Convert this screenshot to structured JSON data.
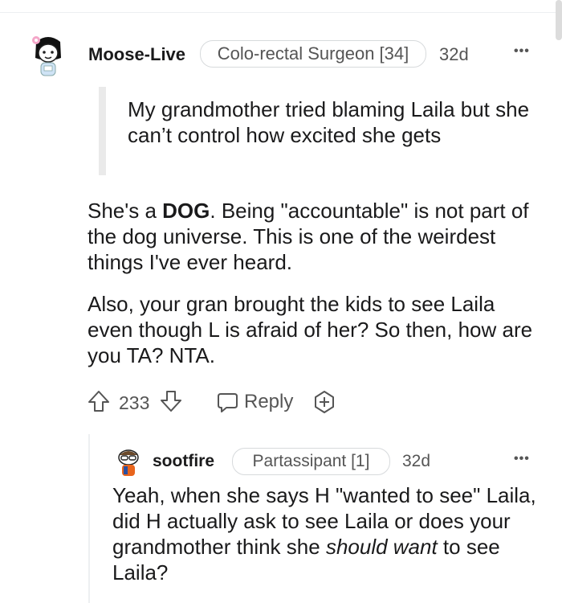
{
  "comment": {
    "username": "Moose-Live",
    "flair": "Colo-rectal Surgeon [34]",
    "age": "32d",
    "more": "•••",
    "quote": "My grandmother tried blaming Laila but she can’t control how excited she gets",
    "para1_prefix": "She's a ",
    "para1_bold": "DOG",
    "para1_suffix": ". Being \"accountable\" is not part of the dog universe. This is one of the weirdest things I've ever heard.",
    "para2": "Also, your gran brought the kids to see Laila even though L is afraid of her? So then, how are you TA? NTA.",
    "upvotes": "233",
    "reply_label": "Reply"
  },
  "reply": {
    "username": "sootfire",
    "flair": "Partassipant [1]",
    "age": "32d",
    "more": "•••",
    "text_prefix": "Yeah, when she says H \"wanted to see\" Laila, did H actually ask to see Laila or does your grandmother think she ",
    "text_italic": "should want",
    "text_suffix": " to see Laila?"
  },
  "icons": {
    "upvote": "arrow-up-icon",
    "downvote": "arrow-down-icon",
    "reply": "speech-bubble-icon",
    "award": "add-award-icon"
  },
  "colors": {
    "text": "#1a1a1b",
    "meta": "#555555",
    "border": "#d7dadc"
  }
}
